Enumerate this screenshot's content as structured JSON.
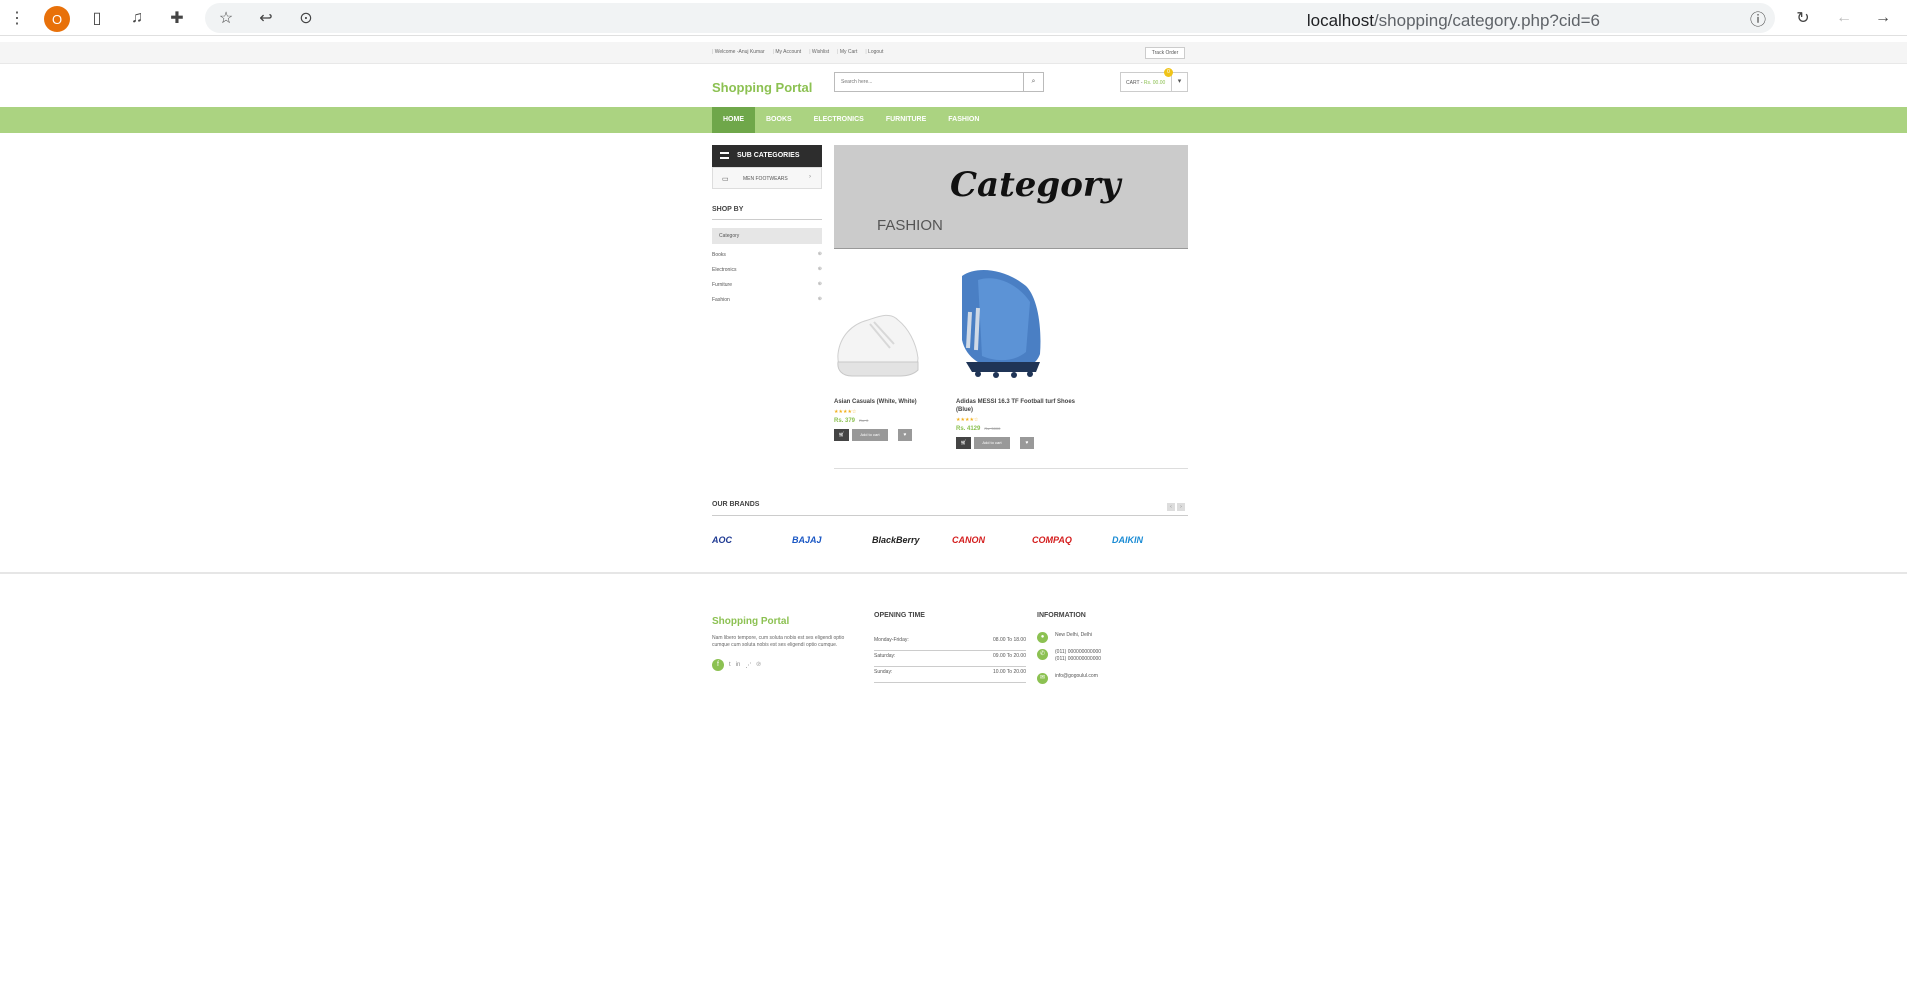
{
  "browser": {
    "profile_initial": "O",
    "url_host": "localhost",
    "url_path": "/shopping/category.php?cid=6"
  },
  "topbar": {
    "links": [
      "Welcome -Anuj Kumar",
      "My Account",
      "Wishlist",
      "My Cart",
      "Logout"
    ],
    "track_order": "Track Order"
  },
  "header": {
    "logo": "Shopping Portal",
    "search_placeholder": "Search here...",
    "cart_label": "CART -",
    "cart_total": "Rs. 00.00",
    "cart_count": "0"
  },
  "nav": [
    "HOME",
    "BOOKS",
    "ELECTRONICS",
    "FURNITURE",
    "FASHION"
  ],
  "sidebar": {
    "subcategories_title": "SUB CATEGORIES",
    "subcategory_item": "MEN FOOTWEARS",
    "shop_by": "SHOP BY",
    "category_label": "Category",
    "categories": [
      "Books",
      "Electronics",
      "Furniture",
      "Fashion"
    ]
  },
  "banner": {
    "title": "Category",
    "subtitle": "FASHION"
  },
  "products": [
    {
      "name": "Asian Casuals (White, White)",
      "rating": 4,
      "price": "Rs. 379",
      "old_price": "Rs. 0",
      "add_label": "Add to cart"
    },
    {
      "name": "Adidas MESSI 16.3 TF Football turf Shoes (Blue)",
      "rating": 4,
      "price": "Rs. 4129",
      "old_price": "Rs. 5000",
      "add_label": "Add to cart"
    }
  ],
  "brands": {
    "title": "OUR BRANDS",
    "items": [
      {
        "name": "AOC",
        "color": "#1f3a93"
      },
      {
        "name": "BAJAJ",
        "color": "#1a57c4"
      },
      {
        "name": "BlackBerry",
        "color": "#222222"
      },
      {
        "name": "CANON",
        "color": "#d41e1e"
      },
      {
        "name": "COMPAQ",
        "color": "#d41e1e"
      },
      {
        "name": "DAIKIN",
        "color": "#1a8bd4"
      }
    ]
  },
  "footer": {
    "logo": "Shopping Portal",
    "text": "Nam libero tempore, cum soluta nobis est ses eligendi optio cumque cum soluta nobis est ses eligendi optio cumque.",
    "opening_title": "OPENING TIME",
    "hours": [
      {
        "day": "Monday-Friday:",
        "time": "08.00 To 18.00"
      },
      {
        "day": "Saturday:",
        "time": "09.00 To 20.00"
      },
      {
        "day": "Sunday:",
        "time": "10.00 To 20.00"
      }
    ],
    "info_title": "INFORMATION",
    "address": "New Delhi, Delhi",
    "phone1": "(011) 000000000000",
    "phone2": "(011) 000000000000",
    "email": "info@gogoulul.com"
  },
  "colors": {
    "accent": "#8cc152",
    "nav_bg": "#abd381"
  }
}
